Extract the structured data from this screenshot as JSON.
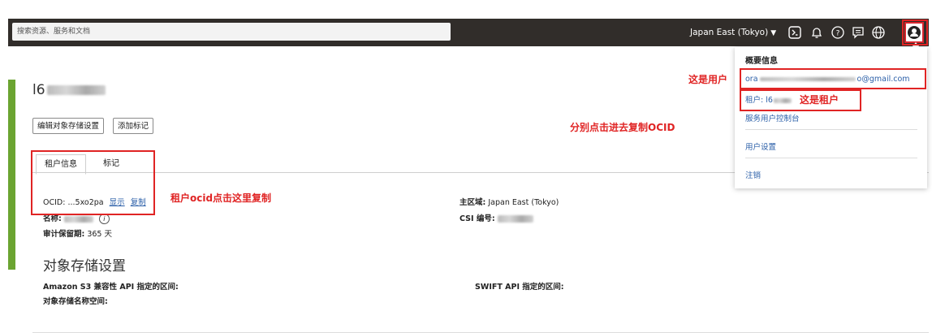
{
  "topbar": {
    "search_placeholder": "搜索资源、服务和文档",
    "region": "Japan East (Tokyo)",
    "icons": [
      "cloud-shell-icon",
      "bell-icon",
      "help-icon",
      "chat-icon",
      "globe-icon",
      "user-icon"
    ]
  },
  "tenancy": {
    "title_prefix": "l6",
    "buttons": {
      "edit": "编辑对象存储设置",
      "add_tag": "添加标记"
    },
    "tabs": [
      "租户信息",
      "标记"
    ],
    "fields": {
      "ocid_label": "OCID:",
      "ocid_value": "...5xo2pa",
      "show_link": "显示",
      "copy_link": "复制",
      "name_label": "名称:",
      "audit_label": "审计保留期:",
      "audit_value": "365 天",
      "home_region_label": "主区域:",
      "home_region_value": "Japan East (Tokyo)",
      "csi_label": "CSI 编号:"
    },
    "object_storage": {
      "title": "对象存储设置",
      "s3_label": "Amazon S3 兼容性 API 指定的区间:",
      "swift_label": "SWIFT API 指定的区间:",
      "namespace_label": "对象存储名称空间:"
    }
  },
  "dropdown": {
    "header": "概要信息",
    "user_prefix": "ora",
    "user_suffix": "o@gmail.com",
    "tenant_prefix": "租户: l6",
    "service_user_console": "服务用户控制台",
    "user_settings": "用户设置",
    "sign_out": "注销"
  },
  "annotations": {
    "this_is_user": "这是用户",
    "this_is_tenant": "这是租户",
    "click_copy_ocid": "分别点击进去复制OCID",
    "tenant_ocid_click": "租户ocid点击这里复制"
  },
  "colors": {
    "topbar": "#312d2a",
    "accent_green": "#6ba431",
    "link": "#2b5fa8",
    "annotation_red": "#e02424"
  }
}
